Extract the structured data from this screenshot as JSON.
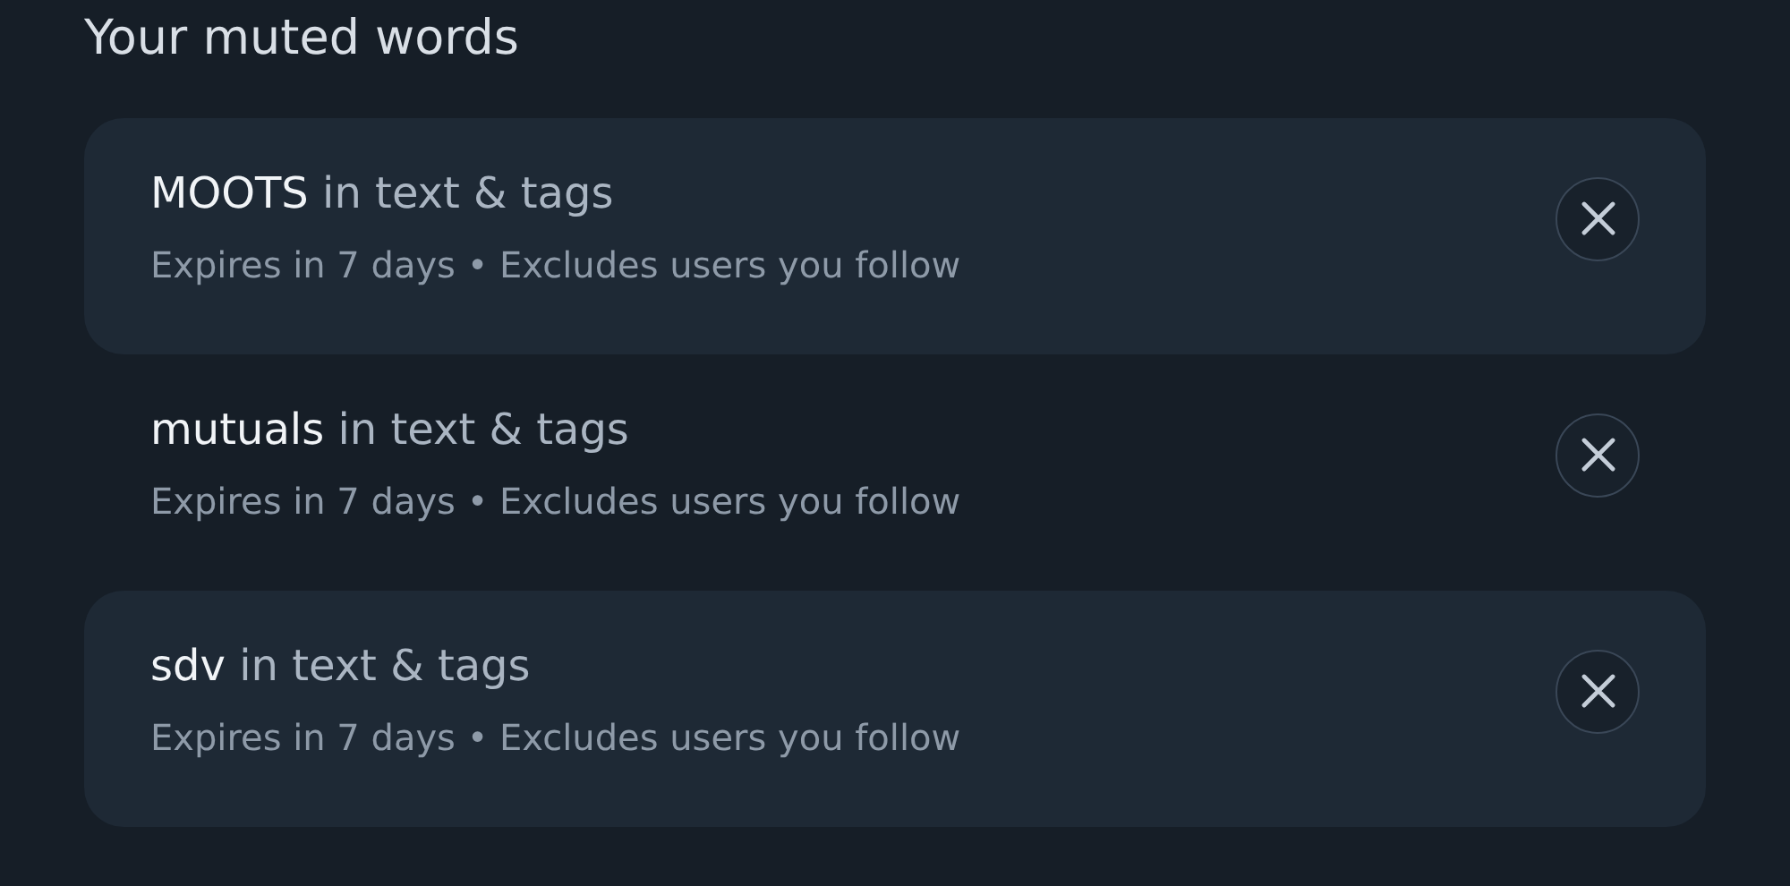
{
  "title": "Your muted words",
  "muted_words": [
    {
      "word": "MOOTS",
      "scope": "in text & tags",
      "details": "Expires in 7 days • Excludes users you follow"
    },
    {
      "word": "mutuals",
      "scope": "in text & tags",
      "details": "Expires in 7 days • Excludes users you follow"
    },
    {
      "word": "sdv",
      "scope": "in text & tags",
      "details": "Expires in 7 days • Excludes users you follow"
    }
  ]
}
